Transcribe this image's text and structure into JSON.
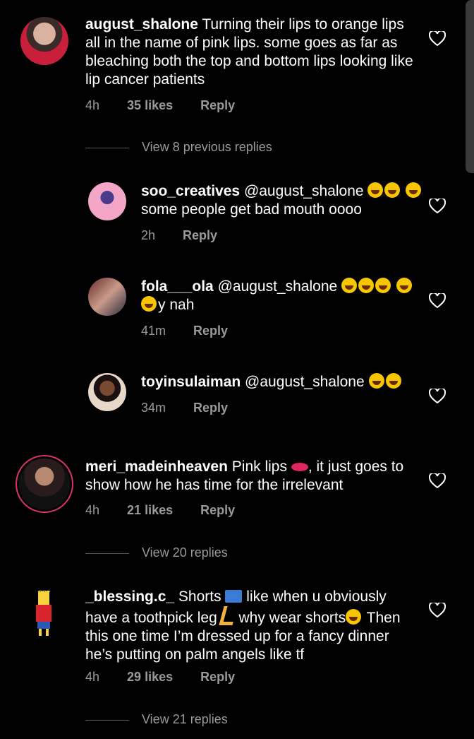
{
  "comments": [
    {
      "username": "august_shalone",
      "text": "Turning their lips to orange lips all in the name of pink lips. some goes as far as bleaching both the top and bottom lips looking like lip cancer patients",
      "time": "4h",
      "likes": "35 likes",
      "reply": "Reply"
    },
    {
      "view": "View 8 previous replies"
    },
    {
      "username": "soo_creatives",
      "text1": "@august_shalone",
      "text2": "some people get bad mouth oooo",
      "time": "2h",
      "reply": "Reply"
    },
    {
      "username": "fola___ola",
      "text1": "@august_shalone",
      "text2": "y nah",
      "time": "41m",
      "reply": "Reply"
    },
    {
      "username": "toyinsulaiman",
      "text1": "@august_shalone",
      "time": "34m",
      "reply": "Reply"
    },
    {
      "username": "meri_madeinheaven",
      "text1": "Pink lips",
      "text2": ", it just goes to show how he has time for the irrelevant",
      "time": "4h",
      "likes": "21 likes",
      "reply": "Reply",
      "view": "View 20 replies"
    },
    {
      "username": "_blessing.c_",
      "text1": "Shorts",
      "text2": "like when u obviously have a toothpick leg",
      "text3": "why wear shorts",
      "text4": "Then this one time I’m dressed up for a fancy dinner he’s putting on palm angels like tf",
      "time": "4h",
      "likes": "29 likes",
      "reply": "Reply",
      "view": "View 21 replies"
    }
  ],
  "colors": {
    "background": "#000000",
    "meta": "#9a9a9a",
    "ring": "#d6336c"
  }
}
